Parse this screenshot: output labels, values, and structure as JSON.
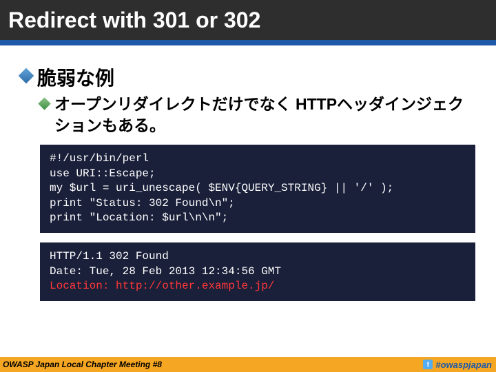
{
  "header": {
    "title": "Redirect with 301 or 302"
  },
  "content": {
    "bullet1": "脆弱な例",
    "bullet2": "オープンリダイレクトだけでなく HTTPヘッダインジェクションもある。",
    "code1_line1": "#!/usr/bin/perl",
    "code1_line2": "use URI::Escape;",
    "code1_line3": "my $url = uri_unescape( $ENV{QUERY_STRING} || '/' );",
    "code1_line4": "print \"Status: 302 Found\\n\";",
    "code1_line5": "print \"Location: $url\\n\\n\";",
    "code2_line1": "HTTP/1.1 302 Found",
    "code2_line2": "Date: Tue, 28 Feb 2013 12:34:56 GMT",
    "code2_line3": "Location: http://other.example.jp/"
  },
  "footer": {
    "left": "OWASP Japan Local Chapter Meeting #8",
    "twitter_glyph": "t",
    "hashtag": "#owaspjapan"
  }
}
